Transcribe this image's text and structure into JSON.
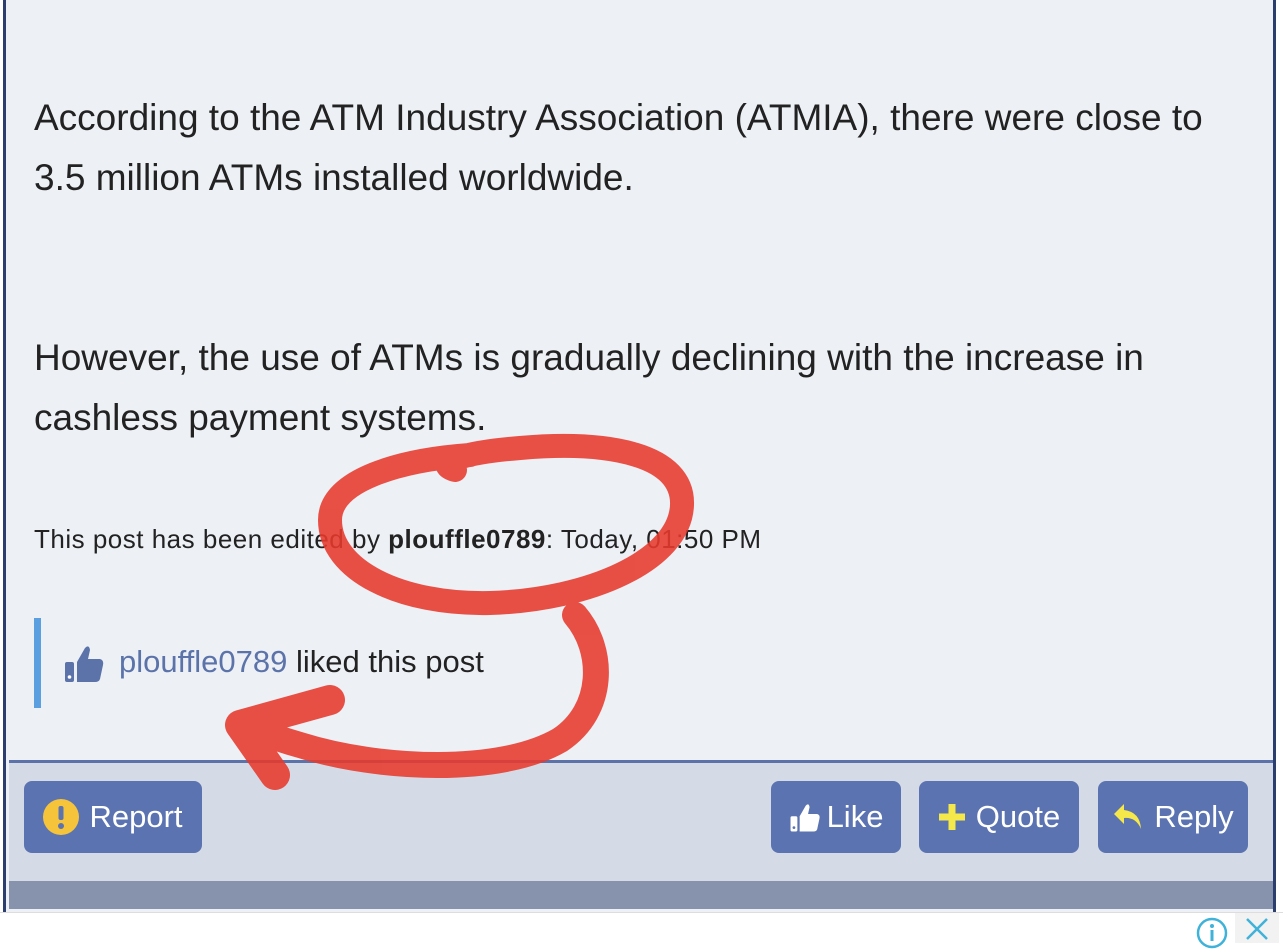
{
  "post": {
    "paragraphs": [
      "According to the ATM Industry Association (ATMIA), there were close to 3.5 million ATMs installed worldwide.",
      "However, the use of ATMs is gradually declining with the increase in cashless payment systems."
    ],
    "edit_note": {
      "prefix": "This post has been edited by ",
      "editor": "plouffle0789",
      "suffix": ": Today, 01:50 PM"
    },
    "likes": {
      "user": "plouffle0789",
      "text": " liked this post"
    }
  },
  "actions": {
    "report_label": "Report",
    "like_label": "Like",
    "quote_label": "Quote",
    "reply_label": "Reply"
  },
  "icons": {
    "report": "exclamation-circle-icon",
    "like": "thumbs-up-icon",
    "quote": "plus-icon",
    "reply": "reply-arrow-icon",
    "ad_info": "info-icon",
    "ad_close": "close-icon"
  },
  "colors": {
    "button_bg": "#5b73b0",
    "action_bar_bg": "#d4dbe6",
    "post_bg": "#edf1f6",
    "link": "#5b73a9",
    "like_accent": "#5aa0e0",
    "annotation": "#e8392c",
    "report_icon": "#f5c43a",
    "quote_icon": "#f5e84a"
  }
}
